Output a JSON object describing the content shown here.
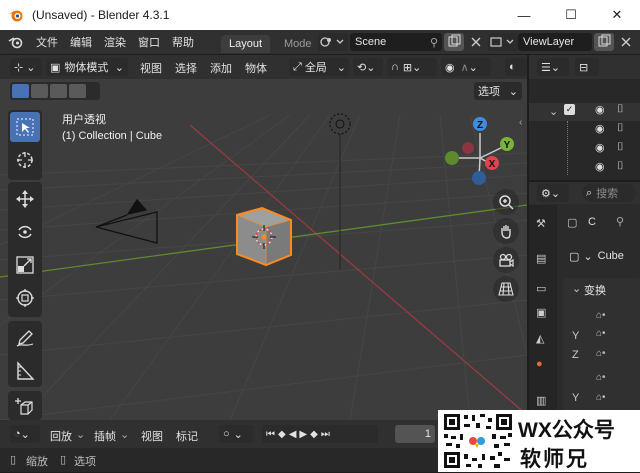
{
  "window": {
    "title": "(Unsaved) - Blender 4.3.1",
    "controls": {
      "minimize": "—",
      "maximize": "☐",
      "close": "✕"
    }
  },
  "menu": {
    "items": [
      "文件",
      "编辑",
      "渲染",
      "窗口",
      "帮助"
    ],
    "workspace_tabs": [
      "Layout",
      "Mode"
    ],
    "scene": "Scene",
    "view_layer": "ViewLayer"
  },
  "viewport_header": {
    "mode": "物体模式",
    "menus": [
      "视图",
      "选择",
      "添加",
      "物体"
    ],
    "transform_orientation": "全局",
    "options": "选项"
  },
  "viewport": {
    "view_name": "用户透视",
    "collection_label": "(1) Collection | Cube",
    "gizmo": {
      "x": "X",
      "y": "Y",
      "z": "Z"
    }
  },
  "properties": {
    "object_short": "C",
    "object_name": "Cube",
    "section_transform": "变换",
    "axis_labels": [
      "Y",
      "Z",
      "Y"
    ],
    "search_placeholder": "搜索"
  },
  "timeline": {
    "menus": [
      "回放",
      "插帧",
      "视图",
      "标记"
    ],
    "current_frame": "1"
  },
  "statusbar": {
    "items": [
      "缩放",
      "选项"
    ]
  },
  "watermark": {
    "line1": "WX公众号",
    "line2": "软师兄"
  },
  "colors": {
    "accent": "#4772b3",
    "selected_outline": "#ff8c1a",
    "axis_x": "#e0434f",
    "axis_y": "#7bb33a",
    "axis_z": "#3f8ddb"
  }
}
